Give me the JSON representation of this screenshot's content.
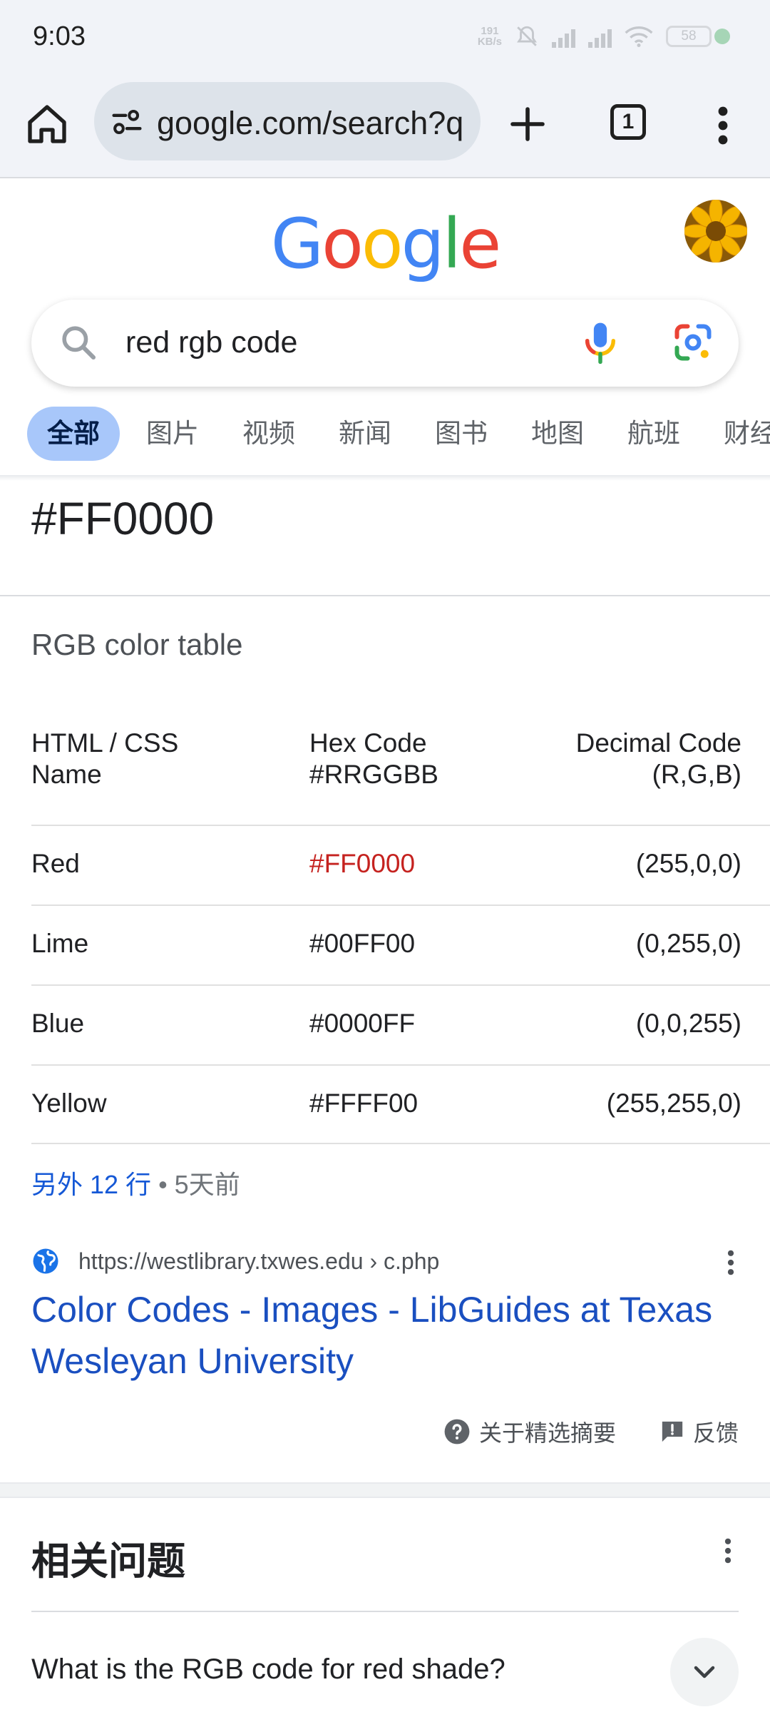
{
  "status_bar": {
    "time": "9:03",
    "net_speed_value": "191",
    "net_speed_unit": "KB/s",
    "battery": "58",
    "icons": [
      "mute-icon",
      "hd-signal-icon",
      "hd-signal-icon",
      "wifi-icon",
      "battery-icon"
    ]
  },
  "browser": {
    "url": "google.com/search?q",
    "tab_count": "1",
    "icons": [
      "home-icon",
      "site-settings-icon",
      "new-tab-icon",
      "tab-switcher-icon",
      "more-vert-icon"
    ]
  },
  "google": {
    "logo_letters": [
      "G",
      "o",
      "o",
      "g",
      "l",
      "e"
    ],
    "logo_colors": [
      "#4285F4",
      "#EA4335",
      "#FBBC05",
      "#4285F4",
      "#34A853",
      "#EA4335"
    ],
    "search_query": "red rgb code"
  },
  "tabs": [
    "全部",
    "图片",
    "视频",
    "新闻",
    "图书",
    "地图",
    "航班",
    "财经"
  ],
  "snippet": {
    "heading": "#FF0000",
    "table_title": "RGB color table",
    "headers": {
      "name_line1": "HTML / CSS",
      "name_line2": "Name",
      "hex_line1": "Hex Code",
      "hex_line2": "#RRGGBB",
      "dec_line1": "Decimal Code",
      "dec_line2": "(R,G,B)"
    },
    "rows": [
      {
        "name": "Red",
        "hex": "#FF0000",
        "dec": "(255,0,0)"
      },
      {
        "name": "Lime",
        "hex": "#00FF00",
        "dec": "(0,255,0)"
      },
      {
        "name": "Blue",
        "hex": "#0000FF",
        "dec": "(0,0,255)"
      },
      {
        "name": "Yellow",
        "hex": "#FFFF00",
        "dec": "(255,255,0)"
      }
    ],
    "more_rows": "另外 12 行",
    "separator": " • ",
    "date": "5天前",
    "source_url": "https://westlibrary.txwes.edu › c.php",
    "result_title": "Color Codes - Images - LibGuides at Texas Wesleyan University",
    "about_label": "关于精选摘要",
    "feedback_label": "反馈"
  },
  "related_questions": {
    "title": "相关问题",
    "questions": [
      "What is the RGB code for red shade?"
    ]
  },
  "colors": {
    "link_blue": "#1a4fc0",
    "accent_red": "#c5221f",
    "active_tab_bg": "#a8c7fa",
    "chrome_bg": "#f1f3f8"
  }
}
